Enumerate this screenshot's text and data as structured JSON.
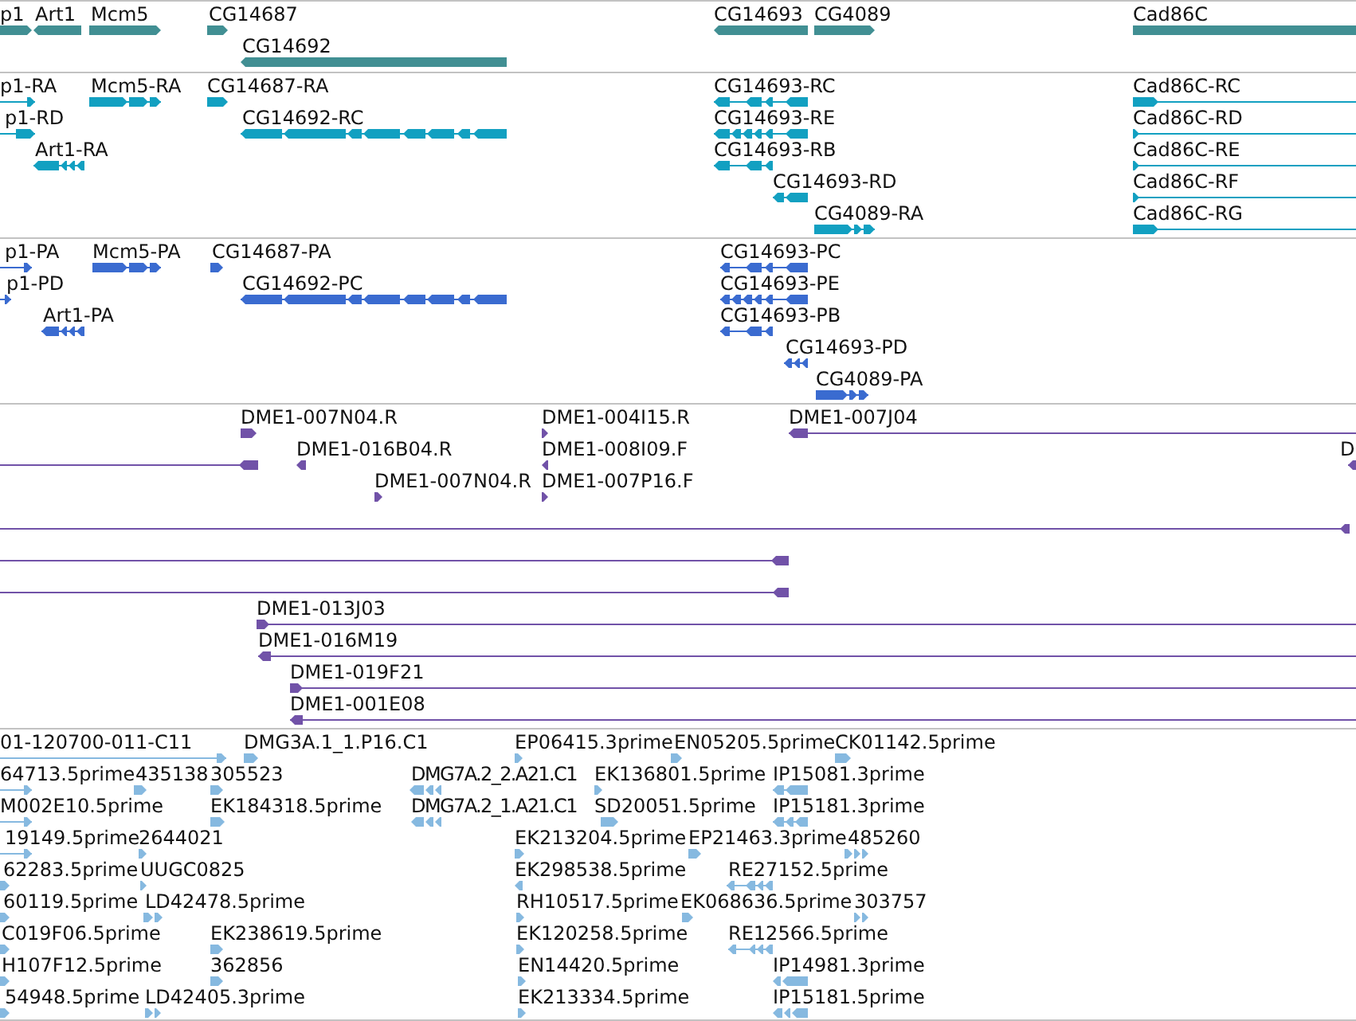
{
  "tracks": [
    {
      "kind": "genes",
      "features": [
        {
          "label": "p1",
          "reverse": false
        },
        {
          "label": "Art1",
          "reverse": true
        },
        {
          "label": "Mcm5",
          "reverse": false
        },
        {
          "label": "CG14687",
          "reverse": false
        },
        {
          "label": "CG14693",
          "reverse": true
        },
        {
          "label": "CG4089",
          "reverse": false
        },
        {
          "label": "Cad86C",
          "reverse": false
        },
        {
          "label": "CG14692",
          "reverse": true
        }
      ]
    },
    {
      "kind": "transcripts",
      "features": [
        {
          "label": "p1-RA",
          "reverse": false
        },
        {
          "label": "Mcm5-RA",
          "reverse": false
        },
        {
          "label": "CG14687-RA",
          "reverse": false
        },
        {
          "label": "CG14693-RC",
          "reverse": true
        },
        {
          "label": "Cad86C-RC",
          "reverse": false
        },
        {
          "label": "p1-RD",
          "reverse": false
        },
        {
          "label": "CG14692-RC",
          "reverse": true
        },
        {
          "label": "CG14693-RE",
          "reverse": true
        },
        {
          "label": "Cad86C-RD",
          "reverse": false
        },
        {
          "label": "Art1-RA",
          "reverse": true
        },
        {
          "label": "CG14693-RB",
          "reverse": true
        },
        {
          "label": "Cad86C-RE",
          "reverse": false
        },
        {
          "label": "CG14693-RD",
          "reverse": true
        },
        {
          "label": "Cad86C-RF",
          "reverse": false
        },
        {
          "label": "CG4089-RA",
          "reverse": false
        },
        {
          "label": "Cad86C-RG",
          "reverse": false
        }
      ]
    },
    {
      "kind": "proteins",
      "features": [
        {
          "label": "p1-PA",
          "reverse": false
        },
        {
          "label": "Mcm5-PA",
          "reverse": false
        },
        {
          "label": "CG14687-PA",
          "reverse": false
        },
        {
          "label": "CG14693-PC",
          "reverse": true
        },
        {
          "label": "p1-PD",
          "reverse": false
        },
        {
          "label": "CG14692-PC",
          "reverse": true
        },
        {
          "label": "CG14693-PE",
          "reverse": true
        },
        {
          "label": "Art1-PA",
          "reverse": true
        },
        {
          "label": "CG14693-PB",
          "reverse": true
        },
        {
          "label": "CG14693-PD",
          "reverse": true
        },
        {
          "label": "CG4089-PA",
          "reverse": false
        }
      ]
    },
    {
      "kind": "clones",
      "features": [
        {
          "label": "DME1-007N04.R",
          "reverse": false
        },
        {
          "label": "DME1-004I15.R",
          "reverse": false
        },
        {
          "label": "DME1-007J04",
          "reverse": true
        },
        {
          "reverse": true
        },
        {
          "label": "DME1-016B04.R",
          "reverse": true
        },
        {
          "label": "DME1-008I09.F",
          "reverse": true
        },
        {
          "label": "D",
          "reverse": true
        },
        {
          "label": "DME1-007N04.R",
          "reverse": false
        },
        {
          "label": "DME1-007P16.F",
          "reverse": false
        },
        {
          "reverse": true
        },
        {
          "reverse": true
        },
        {
          "reverse": true
        },
        {
          "label": "DME1-013J03",
          "reverse": false
        },
        {
          "label": "DME1-016M19",
          "reverse": true
        },
        {
          "label": "DME1-019F21",
          "reverse": false
        },
        {
          "label": "DME1-001E08",
          "reverse": true
        }
      ]
    },
    {
      "kind": "ests",
      "features": [
        {
          "label": "01-120700-011-C11",
          "reverse": false
        },
        {
          "label": "DMG3A.1_1.P16.C1",
          "reverse": false
        },
        {
          "label": "EP06415.3prime",
          "reverse": false
        },
        {
          "label": "EN05205.5prime",
          "reverse": false
        },
        {
          "label": "CK01142.5prime",
          "reverse": false
        },
        {
          "label": "64713.5prime",
          "reverse": false
        },
        {
          "label": "435138",
          "reverse": false
        },
        {
          "label": "305523",
          "reverse": false
        },
        {
          "label": "DMG7A.2_2.A21.C1",
          "reverse": true
        },
        {
          "label": "EK136801.5prime",
          "reverse": false
        },
        {
          "label": "IP15081.3prime",
          "reverse": true
        },
        {
          "label": "M002E10.5prime",
          "reverse": false
        },
        {
          "label": "EK184318.5prime",
          "reverse": false
        },
        {
          "label": "DMG7A.2_1.A21.C1",
          "reverse": true
        },
        {
          "label": "SD20051.5prime",
          "reverse": false
        },
        {
          "label": "IP15181.3prime",
          "reverse": true
        },
        {
          "label": "19149.5prime",
          "reverse": false
        },
        {
          "label": "2644021",
          "reverse": false
        },
        {
          "label": "EK213204.5prime",
          "reverse": false
        },
        {
          "label": "EP21463.3prime",
          "reverse": false
        },
        {
          "label": "485260",
          "reverse": false
        },
        {
          "label": "62283.5prime",
          "reverse": false
        },
        {
          "label": "UUGC0825",
          "reverse": false
        },
        {
          "label": "EK298538.5prime",
          "reverse": true
        },
        {
          "label": "RE27152.5prime",
          "reverse": true
        },
        {
          "label": "60119.5prime",
          "reverse": false
        },
        {
          "label": "LD42478.5prime",
          "reverse": false
        },
        {
          "label": "RH10517.5prime",
          "reverse": false
        },
        {
          "label": "EK068636.5prime",
          "reverse": false
        },
        {
          "label": "303757",
          "reverse": false
        },
        {
          "label": "C019F06.5prime",
          "reverse": false
        },
        {
          "label": "EK238619.5prime",
          "reverse": false
        },
        {
          "label": "EK120258.5prime",
          "reverse": false
        },
        {
          "label": "RE12566.5prime",
          "reverse": true
        },
        {
          "label": "H107F12.5prime",
          "reverse": false
        },
        {
          "label": "362856",
          "reverse": false
        },
        {
          "label": "EN14420.5prime",
          "reverse": false
        },
        {
          "label": "IP14981.3prime",
          "reverse": true
        },
        {
          "label": "54948.5prime",
          "reverse": false
        },
        {
          "label": "LD42405.3prime",
          "reverse": false
        },
        {
          "label": "EK213334.5prime",
          "reverse": false
        },
        {
          "label": "IP15181.5prime",
          "reverse": true
        }
      ]
    }
  ]
}
